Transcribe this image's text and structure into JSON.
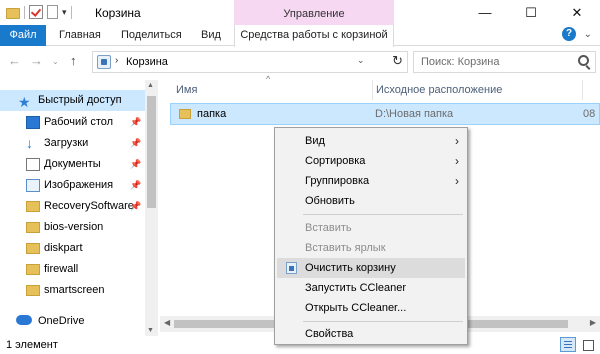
{
  "window": {
    "title": "Корзина",
    "context_tab_header": "Управление",
    "minimize": "—",
    "maximize": "☐",
    "close": "✕"
  },
  "ribbon": {
    "tabs": [
      "Файл",
      "Главная",
      "Поделиться",
      "Вид"
    ],
    "context_tab": "Средства работы с корзиной"
  },
  "address": {
    "path": "Корзина",
    "search_placeholder": "Поиск: Корзина"
  },
  "nav": {
    "quick_access": "Быстрый доступ",
    "items": [
      {
        "label": "Рабочий стол",
        "icon": "desktop-icon",
        "pinned": true
      },
      {
        "label": "Загрузки",
        "icon": "downloads-icon",
        "pinned": true
      },
      {
        "label": "Документы",
        "icon": "documents-icon",
        "pinned": true
      },
      {
        "label": "Изображения",
        "icon": "pictures-icon",
        "pinned": true
      },
      {
        "label": "RecoverySoftware",
        "icon": "folder-icon",
        "pinned": true
      },
      {
        "label": "bios-version",
        "icon": "folder-icon",
        "pinned": false
      },
      {
        "label": "diskpart",
        "icon": "folder-icon",
        "pinned": false
      },
      {
        "label": "firewall",
        "icon": "folder-icon",
        "pinned": false
      },
      {
        "label": "smartscreen",
        "icon": "folder-icon",
        "pinned": false
      }
    ],
    "onedrive": "OneDrive"
  },
  "columns": {
    "name": "Имя",
    "location": "Исходное расположение"
  },
  "files": [
    {
      "name": "папка",
      "location": "D:\\Новая папка",
      "date": "08"
    }
  ],
  "context_menu": {
    "items": [
      {
        "label": "Вид",
        "submenu": true,
        "disabled": false
      },
      {
        "label": "Сортировка",
        "submenu": true,
        "disabled": false
      },
      {
        "label": "Группировка",
        "submenu": true,
        "disabled": false
      },
      {
        "label": "Обновить",
        "submenu": false,
        "disabled": false
      },
      {
        "label": "Вставить",
        "submenu": false,
        "disabled": true
      },
      {
        "label": "Вставить ярлык",
        "submenu": false,
        "disabled": true
      },
      {
        "label": "Очистить корзину",
        "submenu": false,
        "disabled": false,
        "icon": "recycle-bin-icon"
      },
      {
        "label": "Запустить CCleaner",
        "submenu": false,
        "disabled": false
      },
      {
        "label": "Открыть CCleaner...",
        "submenu": false,
        "disabled": false
      },
      {
        "label": "Свойства",
        "submenu": false,
        "disabled": false
      }
    ]
  },
  "status": {
    "text": "1 элемент"
  },
  "colors": {
    "accent": "#1979ca",
    "context_header": "#f6d8f3",
    "selection": "#cce8ff"
  }
}
